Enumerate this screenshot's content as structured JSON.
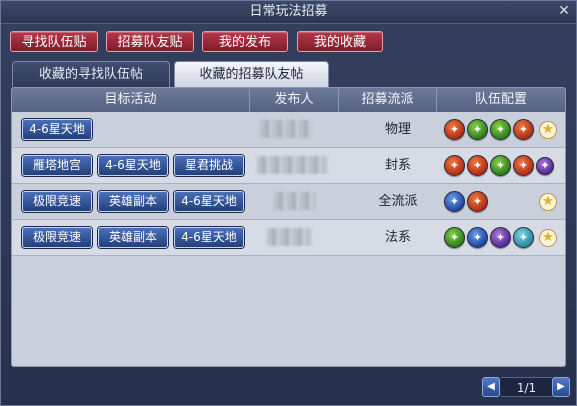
{
  "window": {
    "title": "日常玩法招募",
    "close_glyph": "✕"
  },
  "top_buttons": [
    {
      "label": "寻找队伍贴"
    },
    {
      "label": "招募队友贴"
    },
    {
      "label": "我的发布"
    },
    {
      "label": "我的收藏"
    }
  ],
  "tabs": [
    {
      "label": "收藏的寻找队伍帖",
      "active": false
    },
    {
      "label": "收藏的招募队友帖",
      "active": true
    }
  ],
  "table": {
    "headers": [
      "目标活动",
      "发布人",
      "招募流派",
      "队伍配置"
    ],
    "rows": [
      {
        "activities": [
          "4-6星天地"
        ],
        "school": "物理",
        "team": [
          "fire-emblem-icon",
          "green-emblem-icon",
          "green-emblem-icon",
          "fire-emblem-icon"
        ]
      },
      {
        "activities": [
          "雁塔地宫",
          "4-6星天地",
          "星君挑战"
        ],
        "school": "封系",
        "team": [
          "fire-emblem-icon",
          "fire-emblem-icon",
          "green-emblem-icon",
          "fire-emblem-icon",
          "purple-emblem-icon"
        ]
      },
      {
        "activities": [
          "极限竞速",
          "英雄副本",
          "4-6星天地"
        ],
        "school": "全流派",
        "team": [
          "blue-emblem-icon",
          "fire-emblem-icon"
        ]
      },
      {
        "activities": [
          "极限竞速",
          "英雄副本",
          "4-6星天地"
        ],
        "school": "法系",
        "team": [
          "green-emblem-icon",
          "blue-emblem-icon",
          "purple-emblem-icon",
          "cyan-emblem-icon"
        ]
      }
    ]
  },
  "pager": {
    "text": "1/1",
    "prev_glyph": "◀",
    "next_glyph": "▶"
  },
  "colors": {
    "top_button": "#9a2838",
    "activity_button": "#2f4f92",
    "panel": "#c9cfdb",
    "header": "#5f6b8a"
  }
}
